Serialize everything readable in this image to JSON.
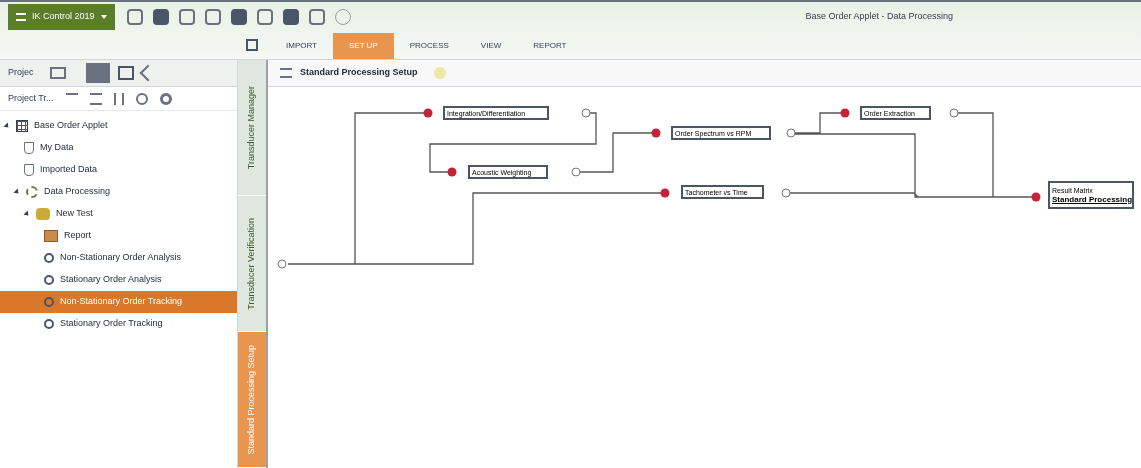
{
  "app_menu": {
    "label": "IK Control 2019"
  },
  "window": {
    "title": "Base Order Applet - Data Processing"
  },
  "ribbon_tabs": [
    {
      "label": "IMPORT",
      "selected": false
    },
    {
      "label": "SET UP",
      "selected": true
    },
    {
      "label": "PROCESS",
      "selected": false
    },
    {
      "label": "VIEW",
      "selected": false
    },
    {
      "label": "REPORT",
      "selected": false
    }
  ],
  "project_panel": {
    "title": "Projec",
    "tree_title": "Project Tr..."
  },
  "tree": [
    {
      "label": "Base Order Applet",
      "kind": "applet",
      "expanded": true,
      "selected": false,
      "children": [
        {
          "label": "My Data",
          "kind": "data",
          "selected": false
        },
        {
          "label": "Imported Data",
          "kind": "data",
          "selected": false
        },
        {
          "label": "Data Processing",
          "kind": "process",
          "expanded": true,
          "selected": false,
          "children": [
            {
              "label": "New Test",
              "kind": "test",
              "expanded": true,
              "selected": false,
              "children": [
                {
                  "label": "Report",
                  "kind": "report",
                  "selected": false
                },
                {
                  "label": "Non-Stationary Order Analysis",
                  "kind": "method",
                  "selected": false
                },
                {
                  "label": "Stationary Order Analysis",
                  "kind": "method",
                  "selected": false
                },
                {
                  "label": "Non-Stationary Order Tracking",
                  "kind": "method",
                  "selected": true
                },
                {
                  "label": "Stationary Order Tracking",
                  "kind": "method",
                  "selected": false
                }
              ]
            }
          ]
        }
      ]
    }
  ],
  "vertical_tabs": [
    {
      "label": "Transducer Manager",
      "selected": false
    },
    {
      "label": "Transducer Verification",
      "selected": false
    },
    {
      "label": "Standard Processing Setup",
      "selected": true
    }
  ],
  "document": {
    "title": "Standard Processing Setup"
  },
  "nodes": [
    {
      "label": "Integration/Differentiation"
    },
    {
      "label": "Acoustic Weighting"
    },
    {
      "label": "Order Spectrum vs RPM"
    },
    {
      "label": "Tachometer vs Time"
    },
    {
      "label": "Order Extraction"
    },
    {
      "label": "Result Matrix",
      "subtitle": "Standard Processing"
    }
  ]
}
